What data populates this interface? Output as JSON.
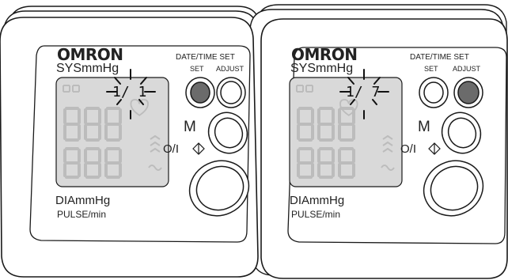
{
  "devices": [
    {
      "brand": "OMRON",
      "sys_label": "SYSmmHg",
      "datetime_set_label": "DATE/TIME SET",
      "set_label": "SET",
      "adjust_label": "ADJUST",
      "memory_label": "M",
      "power_label": "O/I",
      "dia_label": "DIAmmHg",
      "pulse_label": "PULSE/min",
      "lcd_date": "1/ 1",
      "active_button": "set"
    },
    {
      "brand": "OMRON",
      "sys_label": "SYSmmHg",
      "datetime_set_label": "DATE/TIME SET",
      "set_label": "SET",
      "adjust_label": "ADJUST",
      "memory_label": "M",
      "power_label": "O/I",
      "dia_label": "DIAmmHg",
      "pulse_label": "PULSE/min",
      "lcd_date": "1/ 7",
      "active_button": "adjust"
    }
  ],
  "colors": {
    "outline": "#1a1a1a",
    "lcd_bg": "#d9d9d9",
    "lcd_segments": "#bcbcbc",
    "pressed_button": "#6b6b6b",
    "body_fill": "#ffffff"
  }
}
